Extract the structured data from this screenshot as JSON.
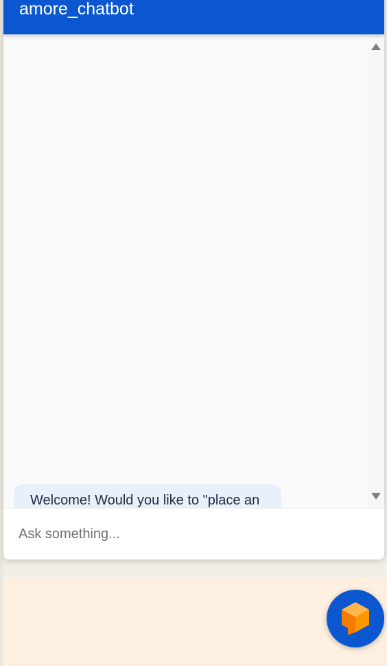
{
  "chat": {
    "title": "amore_chatbot",
    "messages": [
      {
        "sender": "bot",
        "text": "Welcome! Would you like to \"place an order\" or \"reserve a table\"?"
      }
    ],
    "input": {
      "placeholder": "Ask something...",
      "value": ""
    }
  },
  "launcher": {
    "icon": "dialogflow-messenger-icon"
  },
  "colors": {
    "header": "#0b57d0",
    "bubble": "#e8f0fc",
    "page_background": "#fdf0e0",
    "launcher_icon": "#ff9800"
  }
}
